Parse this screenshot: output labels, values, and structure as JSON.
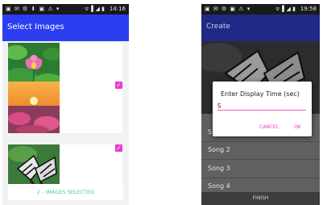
{
  "left_screen": {
    "status": {
      "time": "14:16",
      "icons": "▣ ✉ ⚙ ⬇ ▣ ⚠ ▾",
      "system": "ᯤ ▌◢ ▮"
    },
    "appbar": {
      "title": "Select Images"
    },
    "images": [
      {
        "name": "lotus-flower",
        "selected": false,
        "check_glyph": ""
      },
      {
        "name": "sunset-flowers",
        "selected": true,
        "check_glyph": "✓"
      },
      {
        "name": "butterfly",
        "selected": true,
        "check_glyph": "✓"
      }
    ],
    "footer": {
      "label": "2 - IMAGES SELECTED"
    }
  },
  "right_screen": {
    "status": {
      "time": "19:58",
      "icons": "▣ ✉ ⚙ ▣ ⚠ ▾",
      "system": "ᯤ ▌◢ ▮"
    },
    "appbar": {
      "title": "Create"
    },
    "songs": [
      "Song 2",
      "Song 3",
      "Song 4"
    ],
    "partial_song": "S",
    "finish_label": "FINISH",
    "dialog": {
      "title": "Enter Display Time (sec)",
      "value": "5",
      "cancel_label": "CANCEL",
      "ok_label": "OK"
    }
  },
  "colors": {
    "left_appbar": "#2c3ff0",
    "right_appbar": "#1e2a86",
    "accent_pink": "#e53ad3",
    "footer_text": "#3fd1a0"
  }
}
